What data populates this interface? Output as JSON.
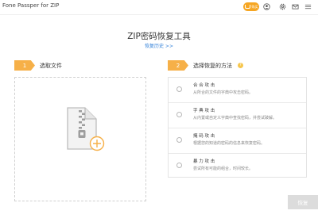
{
  "window": {
    "title": "Fone Passper for ZIP",
    "register_label": "购买",
    "accent_color": "#f6a623",
    "icons": [
      "cart-icon",
      "user-icon",
      "settings-icon",
      "mail-icon",
      "menu-icon"
    ]
  },
  "header": {
    "title": "ZIP密码恢复工具",
    "history_link": "恢复历史 >>"
  },
  "step1": {
    "number": "1",
    "label": "选取文件",
    "dropzone_icons": [
      "zip-file-icon",
      "add-file-icon"
    ]
  },
  "step2": {
    "number": "2",
    "label": "选择恢复的方法",
    "help_icon": "?",
    "methods": [
      {
        "title": "合 合 攻 击",
        "desc": "从所合的文件的字典中攻击密码。"
      },
      {
        "title": "字 典 攻 击",
        "desc": "从内置或自定义字典中查找密码，并尝试破解。"
      },
      {
        "title": "掩 码 攻 击",
        "desc": "根据您的知道的密码的信息来恢复密码。"
      },
      {
        "title": "暴 力 攻 击",
        "desc": "尝试所有可能的组合，时间较长。"
      }
    ]
  },
  "footer": {
    "recover_label": "恢复"
  }
}
